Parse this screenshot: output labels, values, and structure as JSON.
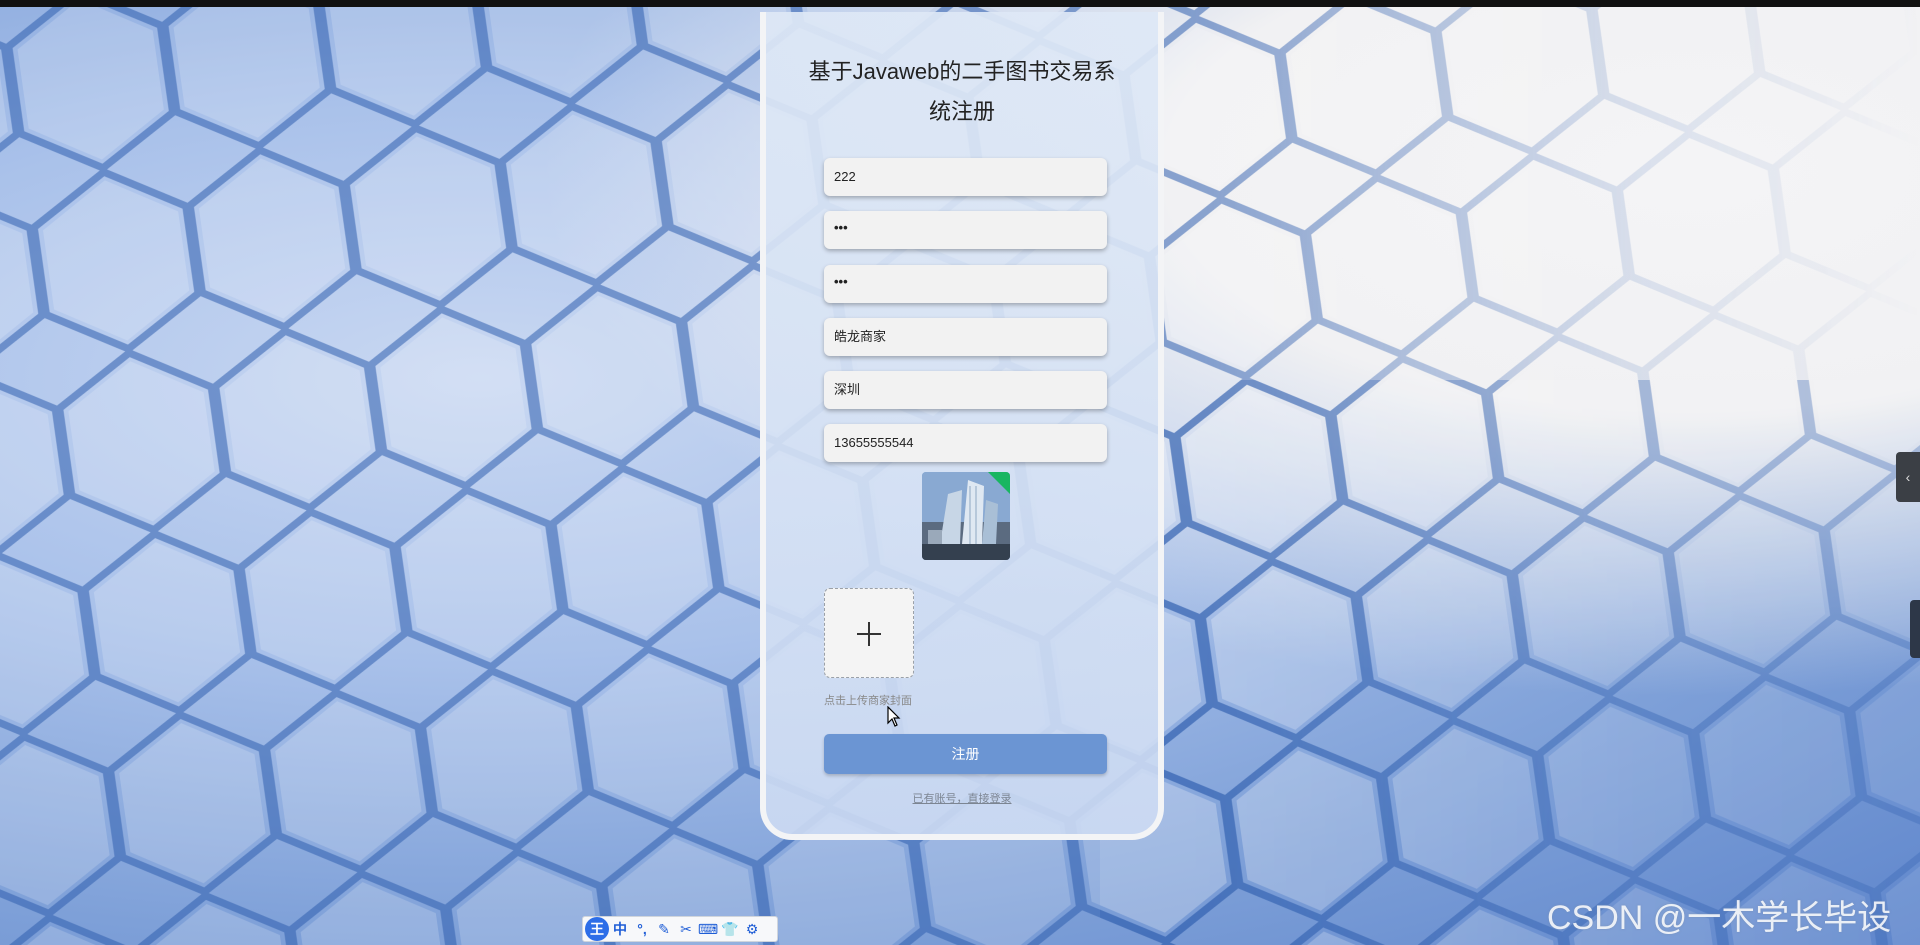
{
  "page": {
    "title": "基于Javaweb的二手图书交易系统注册"
  },
  "form": {
    "username": "222",
    "password": "•••",
    "confirm_password": "•••",
    "shop_name": "皓龙商家",
    "address": "深圳",
    "phone": "13655555544",
    "upload_tip": "点击上传商家封面",
    "submit_label": "注册",
    "login_link": "已有账号，直接登录"
  },
  "side_panel": {
    "collapse_glyph": "‹"
  },
  "ime_toolbar": {
    "logo": "王",
    "mode": "中",
    "items": [
      "°,",
      "✎",
      "✂",
      "⌨",
      "👕",
      "⚙"
    ]
  },
  "watermark": "CSDN @一木学长毕设",
  "colors": {
    "submit": "#6b95d3",
    "upload_success": "#19b661",
    "ime_accent": "#2d6ee8"
  }
}
